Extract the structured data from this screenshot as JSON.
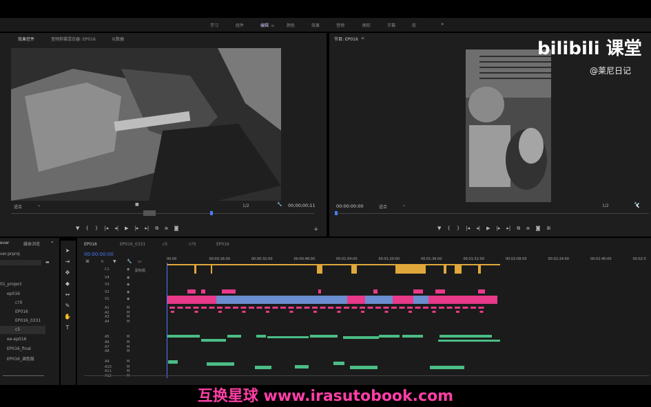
{
  "workspaces": [
    "学习",
    "组件",
    "编辑",
    "颜色",
    "效果",
    "音频",
    "图形",
    "字幕",
    "库"
  ],
  "workspace_active": "编辑",
  "source_tabs": [
    "效果控件",
    "音频剪辑混合器: EP016",
    "元数据"
  ],
  "program_title": "节目: EP016",
  "source_monitor": {
    "fit": "适合",
    "ratio": "1/2",
    "timecode": "00;00;00;11"
  },
  "program_monitor": {
    "timecode": "00:00:00:00",
    "fit": "适合",
    "ratio": "1/2"
  },
  "project": {
    "tabs": [
      "ever",
      "媒体浏览"
    ],
    "file": "ver.prproj",
    "items": [
      "01_project",
      "ep016",
      "c?0",
      "EP016",
      "EP016_0331",
      "c5",
      "ee-ep016",
      "EP016_final",
      "EP016_调色版"
    ]
  },
  "timeline": {
    "tabs": [
      "EP016",
      "EP016_0331",
      "c5",
      "c?0",
      "EP016"
    ],
    "timecode": "00:00:00:00",
    "ruler": [
      "00:00",
      "00:00:16:00",
      "00:00:32:00",
      "00:00:48:00",
      "00:01:04:00",
      "00:01:20:00",
      "00:01:36:00",
      "00:01:52:00",
      "00:02:08:00",
      "00:02:24:00",
      "00:02:40:00",
      "00:02:5"
    ],
    "tracks": [
      "C1",
      "V4",
      "V3",
      "V2",
      "V1",
      "A1",
      "A2",
      "A3",
      "A4",
      "A5",
      "A6",
      "A7",
      "A8",
      "A9",
      "A10",
      "A11",
      "A12"
    ],
    "caption_track": "副标题"
  },
  "branding": {
    "logo": "bilibili 课堂",
    "author": "@莱尼日记"
  },
  "watermark": "互换星球 www.irasutobook.com",
  "colors": {
    "pink": "#e8398a",
    "blue": "#6a8ecf",
    "green": "#4bbd86",
    "gold": "#e0a83a",
    "timeline_blue": "#4a7bff"
  }
}
